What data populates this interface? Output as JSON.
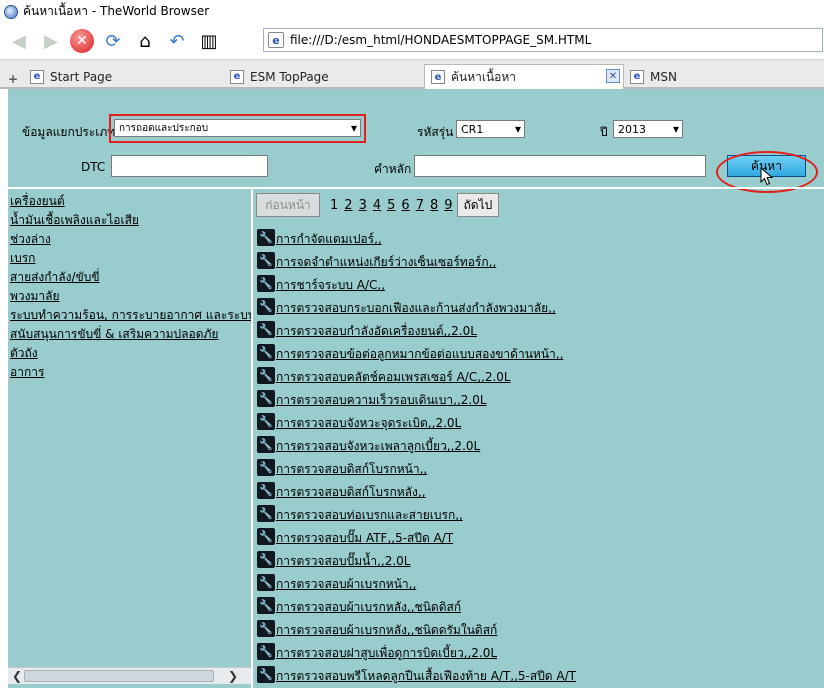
{
  "window": {
    "title": "ค้นหาเนื้อหา - TheWorld Browser"
  },
  "address": {
    "url": "file:///D:/esm_html/HONDAESMTOPPAGE_SM.HTML"
  },
  "tabs": [
    {
      "label": "Start Page"
    },
    {
      "label": "ESM TopPage"
    },
    {
      "label": "ค้นหาเนื้อหา"
    },
    {
      "label": "MSN"
    }
  ],
  "form": {
    "category_label": "ข้อมูลแยกประเภท",
    "category_value": "การถอดและประกอบ",
    "model_label": "รหัสรุ่น",
    "model_value": "CR1",
    "year_label": "ปี",
    "year_value": "2013",
    "dtc_label": "DTC",
    "keyword_label": "คำหลัก",
    "search_button": "ค้นหา"
  },
  "left_links": [
    "เครื่องยนต์",
    "น้ำมันเชื้อเพลิงและไอเสีย",
    "ช่วงล่าง",
    "เบรก",
    "สายส่งกำลัง/ขับขี่",
    "พวงมาลัย",
    "ระบบทำความร้อน, การระบายอากาศ และระบบปรับ",
    "สนับสนุนการขับขี่ & เสริมความปลอดภัย",
    "ตัวถัง",
    "อาการ"
  ],
  "pager": {
    "prev": "ก่อนหน้า",
    "pages": [
      "1",
      "2",
      "3",
      "4",
      "5",
      "6",
      "7",
      "8",
      "9"
    ],
    "next": "ถัดไป"
  },
  "results": [
    "การกำจัดแดมเปอร์,,",
    "การจดจำตำแหน่งเกียร์ว่างเซ็นเซอร์ทอร์ก,,",
    "การชาร์จระบบ A/C,,",
    "การตรวจสอบกระบอกเฟืองและก้านส่งกำลังพวงมาลัย,,",
    "การตรวจสอบกำลังอัดเครื่องยนต์,,2.0L",
    "การตรวจสอบข้อต่อลูกหมากข้อต่อแบบสองขาด้านหน้า,,",
    "การตรวจสอบคลัตช์คอมเพรสเซอร์ A/C,,2.0L",
    "การตรวจสอบความเร็วรอบเดินเบา,,2.0L",
    "การตรวจสอบจังหวะจุดระเบิด,,2.0L",
    "การตรวจสอบจังหวะเพลาลูกเบี้ยว,,2.0L",
    "การตรวจสอบดิสก์โบรกหน้า,,",
    "การตรวจสอบดิสก์โบรกหลัง,,",
    "การตรวจสอบท่อเบรกและสายเบรก,,",
    "การตรวจสอบปั๊ม ATF,,5-สปีด A/T",
    "การตรวจสอบปั๊มน้ำ,,2.0L",
    "การตรวจสอบผ้าเบรกหน้า,,",
    "การตรวจสอบผ้าเบรกหลัง,,ชนิดดิสก์",
    "การตรวจสอบผ้าเบรกหลัง,,ชนิดดรัมในดิสก์",
    "การตรวจสอบฝาสูบเพื่อดูการบิดเบี้ยว,,2.0L",
    "การตรวจสอบพรีโหลดลูกปืนเสื้อเฟืองท้าย A/T,,5-สปีด A/T"
  ]
}
